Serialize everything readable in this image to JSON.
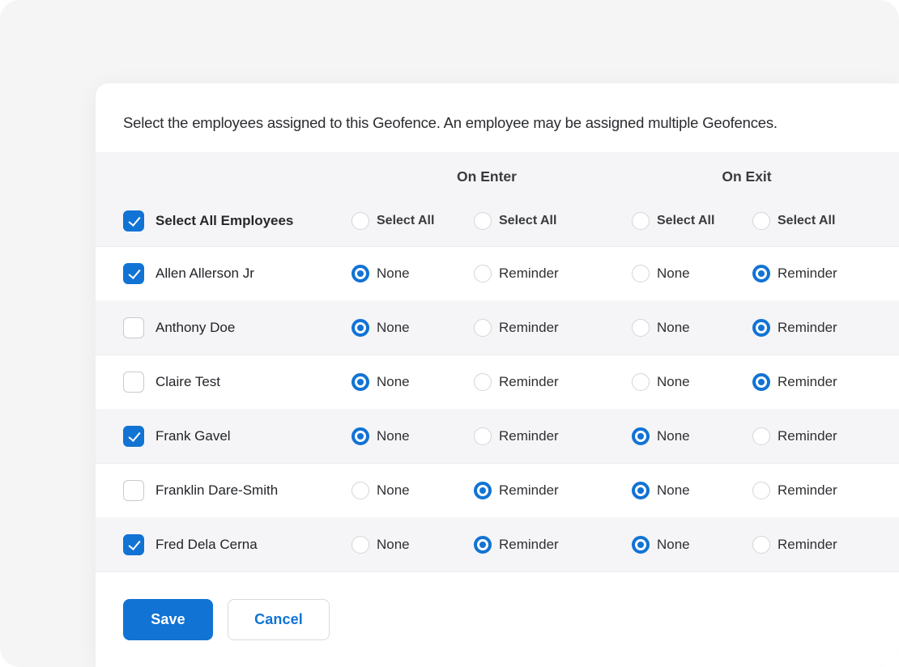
{
  "intro": "Select the employees assigned to this Geofence. An employee may be assigned multiple Geofences.",
  "group_headers": {
    "on_enter": "On Enter",
    "on_exit": "On Exit"
  },
  "select_all": {
    "label": "Select All Employees",
    "checked": true,
    "option_label": "Select All"
  },
  "options": {
    "none": "None",
    "reminder": "Reminder"
  },
  "employees": [
    {
      "name": "Allen Allerson Jr",
      "checked": true,
      "on_enter": "None",
      "on_exit": "Reminder"
    },
    {
      "name": "Anthony Doe",
      "checked": false,
      "on_enter": "None",
      "on_exit": "Reminder"
    },
    {
      "name": "Claire Test",
      "checked": false,
      "on_enter": "None",
      "on_exit": "Reminder"
    },
    {
      "name": "Frank Gavel",
      "checked": true,
      "on_enter": "None",
      "on_exit": "None"
    },
    {
      "name": "Franklin Dare-Smith",
      "checked": false,
      "on_enter": "Reminder",
      "on_exit": "None"
    },
    {
      "name": "Fred Dela Cerna",
      "checked": true,
      "on_enter": "Reminder",
      "on_exit": "None"
    }
  ],
  "actions": {
    "save": "Save",
    "cancel": "Cancel"
  },
  "colors": {
    "accent": "#1173d4",
    "row_stripe": "#f5f5f7",
    "page_background": "#f5f5f6"
  }
}
